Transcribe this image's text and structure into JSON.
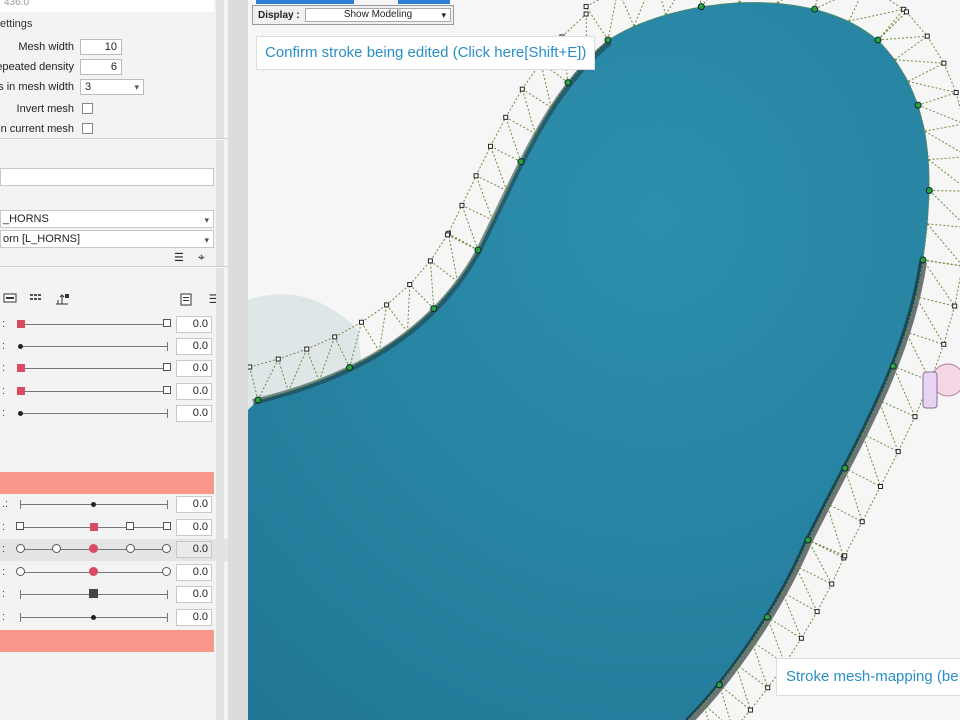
{
  "left_panel": {
    "top_value": "436.0",
    "section_title": "ettings",
    "props": [
      {
        "label": "Mesh width",
        "value": "10"
      },
      {
        "label": "Repeated density",
        "value": "6"
      },
      {
        "label": "es in mesh width",
        "value": "3"
      },
      {
        "label": "Invert mesh"
      },
      {
        "label": "ain current mesh"
      }
    ],
    "fields": {
      "empty": "",
      "part1": "_HORNS",
      "part2": "orn  [L_HORNS]"
    },
    "slider_groups": {
      "group1": [
        "0.0",
        "0.0",
        "0.0",
        "0.0",
        "0.0"
      ],
      "group2": [
        "0.0",
        "0.0",
        "0.0",
        "0.0",
        "0.0",
        "0.0"
      ]
    },
    "colors": {
      "accent_red": "#d94a63",
      "salmon": "#f9978a"
    }
  },
  "canvas": {
    "display_label": "Display :",
    "display_value": "Show Modeling",
    "tooltip_top": "Confirm stroke being edited (Click here[Shift+E])",
    "tooltip_bottom": "Stroke mesh-mapping (be",
    "colors": {
      "fill": "#2a8aa8",
      "mesh": "#6f8a3a",
      "edge": "#27a43a"
    }
  },
  "icons": {
    "chevron": "▾",
    "list": "☰",
    "target": "⌖"
  }
}
